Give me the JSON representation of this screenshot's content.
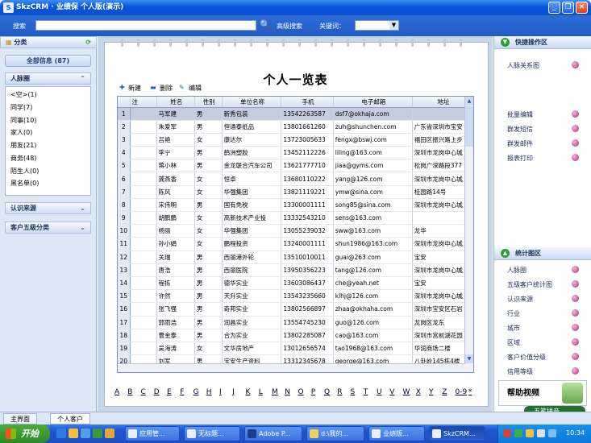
{
  "window": {
    "title": "SkzCRM · 业绩保 个人版(演示)",
    "buttons": [
      "_",
      "❐",
      "✕"
    ]
  },
  "search": {
    "label": "搜索",
    "advanced": "高级搜索",
    "keyword_label": "关键词：",
    "keyword_value": ""
  },
  "left": {
    "category_title": "分类",
    "all_info": "全部信息 (87)",
    "people_circle": {
      "title": "人脉圈",
      "items": [
        "<空>(1)",
        "同学(7)",
        "同事(10)",
        "家人(0)",
        "朋友(21)",
        "商务(48)",
        "陌生人(0)",
        "黑名单(0)"
      ]
    },
    "source_title": "认识来源",
    "five_class_title": "客户五级分类"
  },
  "main": {
    "title": "个人一览表",
    "toolbar": {
      "new": "新建",
      "delete": "删除",
      "edit": "编辑"
    },
    "columns": [
      "注",
      "姓名",
      "性别",
      "单位名称",
      "手机",
      "电子邮箱",
      "地址"
    ],
    "rows": [
      [
        "1",
        "马军建",
        "男",
        "新秀包装",
        "13542263587",
        "dsf7@okhaja.com",
        ""
      ],
      [
        "2",
        "朱爱军",
        "男",
        "恒通泰纸品",
        "13801661260",
        "zuh@shunchen.com",
        "广东省深圳市宝安"
      ],
      [
        "3",
        "吕艳",
        "女",
        "康达尔",
        "13723005633",
        "fengx@bswj.com",
        "福田区振兴路上步"
      ],
      [
        "4",
        "李宁",
        "男",
        "鹤洲塑胶",
        "13452112226",
        "liling@163.com",
        "深圳市龙岗中心城"
      ],
      [
        "5",
        "蒋小林",
        "男",
        "金龙联合汽车公司",
        "13621777710",
        "jiaa@gyms.com",
        "松岗广深路段377"
      ],
      [
        "6",
        "龚燕香",
        "女",
        "恒卓",
        "13680110222",
        "yang@126.com",
        "深圳市龙岗中心城"
      ],
      [
        "7",
        "陈风",
        "女",
        "华强集团",
        "13821119221",
        "ymw@sina.com",
        "桂园路14号"
      ],
      [
        "8",
        "宋伟明",
        "男",
        "国有免税",
        "13300001111",
        "song85@sina.com",
        "深圳市龙岗中心城"
      ],
      [
        "9",
        "胡鹏鹏",
        "女",
        "高新技术产业投",
        "13332543210",
        "sens@163.com",
        ""
      ],
      [
        "10",
        "杨丽",
        "女",
        "华强集团",
        "13055239032",
        "sww@163.com",
        "龙华"
      ],
      [
        "11",
        "孙小娟",
        "女",
        "鹏程投资",
        "13240001111",
        "shun1986@163.com",
        "深圳市龙岗中心城"
      ],
      [
        "12",
        "关瑞",
        "男",
        "西丽港外轮",
        "13510010011",
        "guai@263.com",
        "宝安"
      ],
      [
        "13",
        "唐浩",
        "男",
        "西丽医院",
        "13950356223",
        "tang@126.com",
        "深圳市龙岗中心城"
      ],
      [
        "14",
        "程栋",
        "男",
        "德华实业",
        "13603086437",
        "che@yeah.net",
        "宝安"
      ],
      [
        "15",
        "许然",
        "男",
        "天升实业",
        "13543235660",
        "klhj@126.com",
        "深圳市龙岗中心城"
      ],
      [
        "16",
        "张飞强",
        "男",
        "奇邦实业",
        "13802566897",
        "zhaa@okhaha.com",
        "深圳市宝安区石岩"
      ],
      [
        "17",
        "郭雨浩",
        "男",
        "润昌实业",
        "13554745230",
        "guo@126.com",
        "龙岗区龙东"
      ],
      [
        "18",
        "曹金泰",
        "男",
        "合为实业",
        "13802285087",
        "cao@163.com",
        "深圳市宫前湖花园"
      ],
      [
        "19",
        "吴海涛",
        "女",
        "文华房地产",
        "13012656574",
        "tao1968@163.com",
        "华润商场二楼"
      ],
      [
        "20",
        "刘军",
        "男",
        "宝安生产资料",
        "13312345678",
        "george@163.com",
        "八卦岭145栋4楼"
      ],
      [
        "21",
        "李艳",
        "女",
        "凯利莱酒店",
        "13874221305",
        "sales@kindlion.com",
        ""
      ]
    ],
    "alphabet": [
      "A",
      "B",
      "C",
      "D",
      "E",
      "F",
      "G",
      "H",
      "I",
      "J",
      "K",
      "L",
      "M",
      "N",
      "O",
      "P",
      "Q",
      "R",
      "S",
      "T",
      "U",
      "V",
      "W",
      "X",
      "Y",
      "Z",
      "0-9",
      "*"
    ]
  },
  "right": {
    "quick_title": "快捷操作区",
    "quick_items": [
      "人脉关系图",
      "批量编辑",
      "群发短信",
      "群发邮件",
      "报表打印"
    ],
    "stats_title": "统计图区",
    "stats_items": [
      "人脉圈",
      "五级客户统计图",
      "认识来源",
      "行业",
      "城市",
      "区域",
      "客户价值分级",
      "信用等级"
    ],
    "help_video": "帮助视频",
    "ime": "五笔拼音"
  },
  "tabs": [
    "主界面",
    "个人客户"
  ],
  "taskbar": {
    "start": "开始",
    "tasks": [
      "应用管...",
      "无标题...",
      "Adobe P...",
      "d:\\我的...",
      "业绩版...",
      "SkzCRM..."
    ],
    "clock": "10:34"
  }
}
